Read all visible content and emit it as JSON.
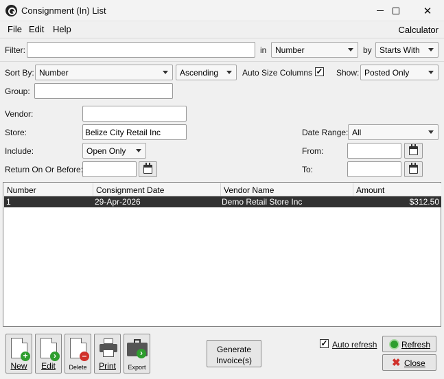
{
  "window": {
    "title": "Consignment (In) List"
  },
  "menu": {
    "file": "File",
    "edit": "Edit",
    "help": "Help",
    "calculator": "Calculator"
  },
  "filter": {
    "label": "Filter:",
    "value": "",
    "in_label": "in",
    "field": "Number",
    "by_label": "by",
    "mode": "Starts With"
  },
  "sort": {
    "label": "Sort By:",
    "field": "Number",
    "direction": "Ascending",
    "auto_size_label": "Auto Size Columns",
    "auto_size_checked": "✓",
    "show_label": "Show:",
    "show_value": "Posted Only"
  },
  "group": {
    "label": "Group:",
    "value": ""
  },
  "vendor": {
    "label": "Vendor:",
    "value": ""
  },
  "store": {
    "label": "Store:",
    "value": "Belize City Retail Inc"
  },
  "include": {
    "label": "Include:",
    "value": "Open Only"
  },
  "return_on": {
    "label": "Return On Or Before:",
    "value": ""
  },
  "date_range": {
    "label": "Date Range:",
    "value": "All",
    "from_label": "From:",
    "from_value": "",
    "to_label": "To:",
    "to_value": ""
  },
  "grid": {
    "columns": [
      "Number",
      "Consignment Date",
      "Vendor Name",
      "Amount"
    ],
    "rows": [
      {
        "number": "1",
        "date": "29-Apr-2026",
        "vendor": "Demo Retail Store Inc",
        "amount": "$312.50"
      }
    ]
  },
  "buttons": {
    "new": "New",
    "edit": "Edit",
    "delete": "Delete",
    "print": "Print",
    "export": "Export",
    "generate_line1": "Generate",
    "generate_line2": "Invoice(s)",
    "auto_refresh_label": "Auto refresh",
    "auto_refresh_checked": "✓",
    "refresh": "Refresh",
    "close": "Close"
  },
  "colors": {
    "selected_row": "#323232",
    "new_badge": "#2e9e2e",
    "delete_badge": "#d0302a",
    "close_x": "#d0302a"
  }
}
